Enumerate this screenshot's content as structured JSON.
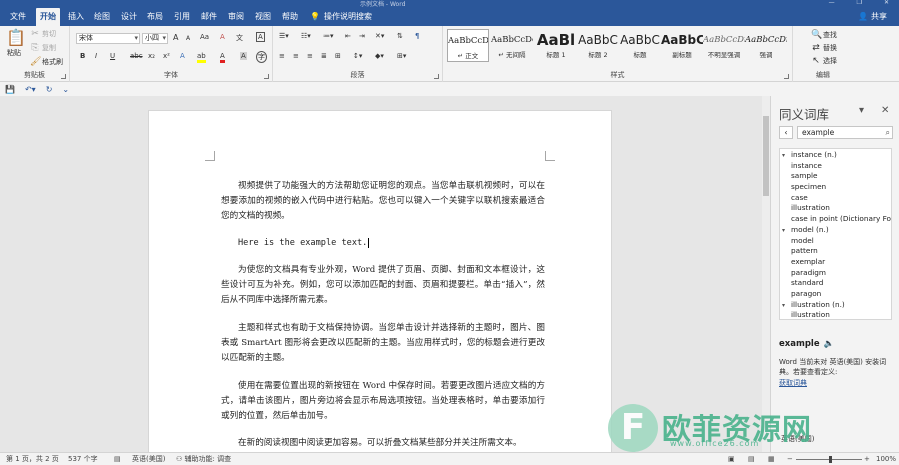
{
  "titlebar": {
    "title": "示例文档 - Word",
    "minimize": "—",
    "restore": "❐",
    "close": "✕"
  },
  "tabs": [
    "文件",
    "开始",
    "插入",
    "绘图",
    "设计",
    "布局",
    "引用",
    "邮件",
    "审阅",
    "视图",
    "帮助"
  ],
  "tell_me": "操作说明搜索",
  "share": "共享",
  "clipboard": {
    "paste": "粘贴",
    "cut": "剪切",
    "copy": "复制",
    "format_painter": "格式刷",
    "label": "剪贴板"
  },
  "font": {
    "name": "宋体",
    "size": "小四",
    "label": "字体",
    "grow": "A",
    "shrink": "A",
    "aa": "Aa",
    "clear": "A",
    "wen": "文",
    "border_a": "A",
    "bold": "B",
    "italic": "I",
    "underline": "U",
    "strike": "abc",
    "sub": "x₂",
    "sup": "x²",
    "effects": "A",
    "highlight": "ab",
    "color": "A",
    "shade": "A",
    "circle": "字"
  },
  "paragraph": {
    "label": "段落"
  },
  "styles": {
    "label": "样式",
    "items": [
      {
        "sample": "AaBbCcDc",
        "name": "↵ 正文"
      },
      {
        "sample": "AaBbCcDc",
        "name": "↵ 无间隔"
      },
      {
        "sample": "AaBl",
        "name": "标题 1"
      },
      {
        "sample": "AaBbC",
        "name": "标题 2"
      },
      {
        "sample": "AaBbC",
        "name": "标题"
      },
      {
        "sample": "AaBbC",
        "name": "副标题"
      },
      {
        "sample": "AaBbCcDi",
        "name": "不明显强调"
      },
      {
        "sample": "AaBbCcDi",
        "name": "强调"
      }
    ]
  },
  "editing": {
    "find": "查找",
    "replace": "替换",
    "select": "选择",
    "label": "编辑"
  },
  "document": {
    "paragraphs": [
      "视频提供了功能强大的方法帮助您证明您的观点。当您单击联机视频时，可以在想要添加的视频的嵌入代码中进行粘贴。您也可以键入一个关键字以联机搜索最适合您的文档的视频。",
      "Here is the example text.",
      "为使您的文档具有专业外观，Word 提供了页眉、页脚、封面和文本框设计，这些设计可互为补充。例如，您可以添加匹配的封面、页眉和提要栏。单击“插入”，然后从不同库中选择所需元素。",
      "主题和样式也有助于文档保持协调。当您单击设计并选择新的主题时，图片、图表或 SmartArt 图形将会更改以匹配新的主题。当应用样式时，您的标题会进行更改以匹配新的主题。",
      "使用在需要位置出现的新按钮在 Word 中保存时间。若要更改图片适应文档的方式，请单击该图片，图片旁边将会显示布局选项按钮。当处理表格时，单击要添加行或列的位置，然后单击加号。",
      "在新的阅读视图中阅读更加容易。可以折叠文档某些部分并关注所需文本。"
    ]
  },
  "thesaurus": {
    "title": "同义词库",
    "search_value": "example",
    "list": [
      {
        "kind": "head",
        "text": "instance (n.)"
      },
      {
        "kind": "syn",
        "text": "instance"
      },
      {
        "kind": "syn",
        "text": "sample"
      },
      {
        "kind": "syn",
        "text": "specimen"
      },
      {
        "kind": "syn",
        "text": "case"
      },
      {
        "kind": "syn",
        "text": "illustration"
      },
      {
        "kind": "syn",
        "text": "case in point (Dictionary Fo"
      },
      {
        "kind": "head",
        "text": "model (n.)"
      },
      {
        "kind": "syn",
        "text": "model"
      },
      {
        "kind": "syn",
        "text": "pattern"
      },
      {
        "kind": "syn",
        "text": "exemplar"
      },
      {
        "kind": "syn",
        "text": "paradigm"
      },
      {
        "kind": "syn",
        "text": "standard"
      },
      {
        "kind": "syn",
        "text": "paragon"
      },
      {
        "kind": "head",
        "text": "illustration (n.)"
      },
      {
        "kind": "syn",
        "text": "illustration"
      }
    ],
    "word": "example",
    "info": "Word 当前未对 英语(美国) 安装词典。若要查看定义:",
    "link": "获取词典",
    "language": "英语(美国)"
  },
  "status": {
    "page": "第 1 页，共 2 页",
    "words": "537 个字",
    "language": "英语(美国)",
    "accessibility": "辅助功能: 调查",
    "zoom": "100%"
  },
  "watermark": {
    "text": "欧菲资源网",
    "url": "www.office26.com",
    "logo": "F"
  }
}
